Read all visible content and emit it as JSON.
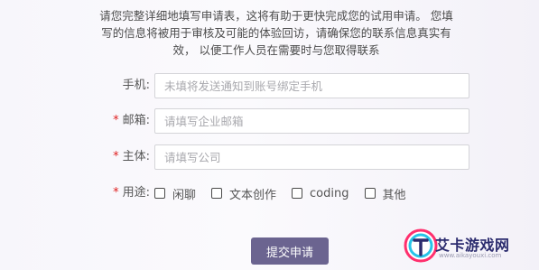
{
  "intro": "请您完整详细地填写申请表，这将有助于更快完成您的试用申请。 您填写的信息将被用于审核及可能的体验回访，请确保您的联系信息真实有效， 以便工作人员在需要时与您取得联系",
  "fields": {
    "phone": {
      "label": "手机:",
      "required": false,
      "placeholder": "未填将发送通知到账号绑定手机",
      "value": ""
    },
    "email": {
      "label": "邮箱:",
      "required": true,
      "placeholder": "请填写企业邮箱",
      "value": ""
    },
    "entity": {
      "label": "主体:",
      "required": true,
      "placeholder": "请填写公司",
      "value": ""
    },
    "purpose": {
      "label": "用途:",
      "required": true,
      "options": [
        {
          "label": "闲聊",
          "checked": false
        },
        {
          "label": "文本创作",
          "checked": false
        },
        {
          "label": "coding",
          "checked": false
        },
        {
          "label": "其他",
          "checked": false
        }
      ]
    }
  },
  "required_mark": "*",
  "submit_label": "提交申请",
  "watermark": {
    "text": "艾卡游戏网",
    "sub": "www.aikayouxi.com"
  },
  "colors": {
    "accent": "#6b6490",
    "required": "#e02020",
    "watermark": "#2b2b6e"
  }
}
